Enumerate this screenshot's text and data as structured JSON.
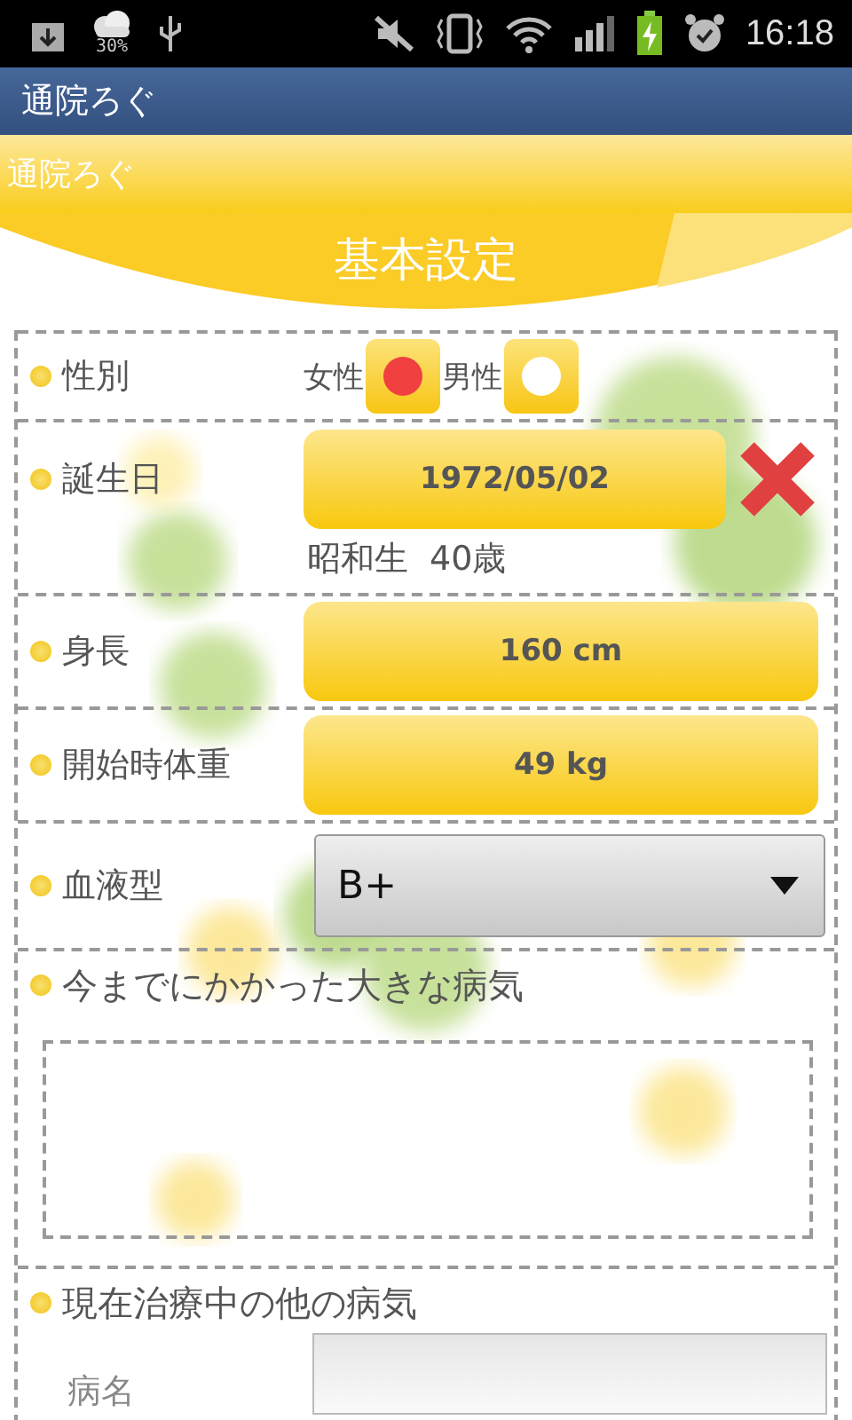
{
  "status_bar": {
    "weather_text": "30%",
    "time": "16:18"
  },
  "app_bar": {
    "title": "通院ろぐ"
  },
  "header": {
    "title": "通院ろぐ"
  },
  "section": {
    "title": "基本設定"
  },
  "fields": [
    {
      "kind": "radio",
      "label": "性別",
      "options": [
        {
          "label": "女性",
          "selected": true
        },
        {
          "label": "男性",
          "selected": false
        }
      ]
    },
    {
      "kind": "date",
      "label": "誕生日",
      "value": "1972/05/02",
      "era": "昭和生",
      "age": "40歳"
    },
    {
      "kind": "button",
      "label": "身長",
      "value": "160 cm"
    },
    {
      "kind": "button",
      "label": "開始時体重",
      "value": "49 kg"
    },
    {
      "kind": "select",
      "label": "血液型",
      "value": "B+"
    },
    {
      "kind": "textarea",
      "label": "今までにかかった大きな病気"
    },
    {
      "kind": "subform",
      "label": "現在治療中の他の病気",
      "sub_label": "病名"
    }
  ]
}
